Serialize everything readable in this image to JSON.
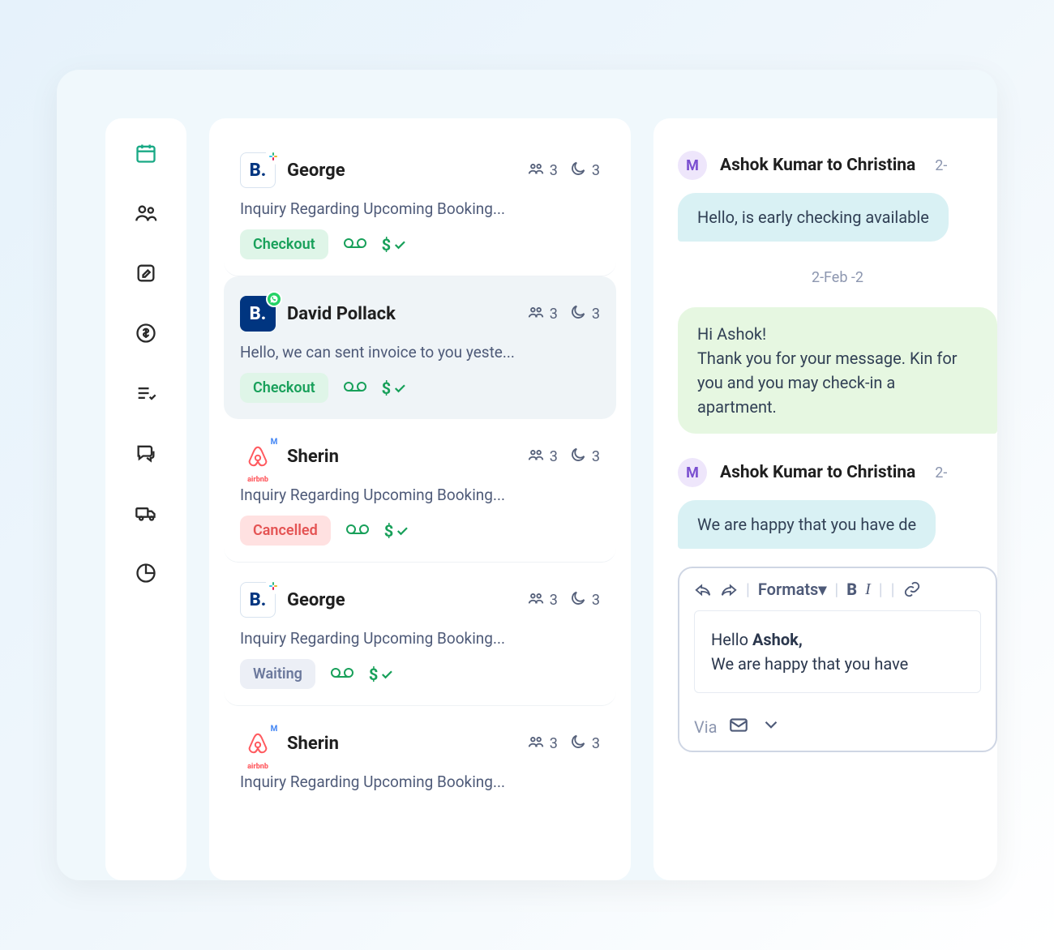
{
  "sidebar": {
    "items": [
      {
        "name": "calendar-icon",
        "active": true
      },
      {
        "name": "guests-icon",
        "active": false
      },
      {
        "name": "notes-icon",
        "active": false
      },
      {
        "name": "payments-icon",
        "active": false
      },
      {
        "name": "tasks-icon",
        "active": false
      },
      {
        "name": "chat-icon",
        "active": false
      },
      {
        "name": "truck-icon",
        "active": false
      },
      {
        "name": "reports-icon",
        "active": false
      }
    ]
  },
  "inbox": [
    {
      "source": "booking-alt",
      "overlay": "slack",
      "name": "George",
      "guests": "3",
      "nights": "3",
      "preview": "Inquiry Regarding Upcoming Booking...",
      "status": "Checkout",
      "status_kind": "checkout",
      "selected": false
    },
    {
      "source": "booking",
      "overlay": "whatsapp",
      "name": "David Pollack",
      "guests": "3",
      "nights": "3",
      "preview": "Hello, we can sent invoice to you yeste...",
      "status": "Checkout",
      "status_kind": "checkout",
      "selected": true
    },
    {
      "source": "airbnb",
      "overlay": "gmail",
      "name": "Sherin",
      "guests": "3",
      "nights": "3",
      "preview": "Inquiry Regarding Upcoming Booking...",
      "status": "Cancelled",
      "status_kind": "cancelled",
      "selected": false
    },
    {
      "source": "booking-alt",
      "overlay": "slack",
      "name": "George",
      "guests": "3",
      "nights": "3",
      "preview": "Inquiry Regarding Upcoming Booking...",
      "status": "Waiting",
      "status_kind": "waiting",
      "selected": false
    },
    {
      "source": "airbnb",
      "overlay": "gmail",
      "name": "Sherin",
      "guests": "3",
      "nights": "3",
      "preview": "Inquiry Regarding Upcoming Booking...",
      "status": "",
      "status_kind": "",
      "selected": false
    }
  ],
  "chat": {
    "avatar_initial": "M",
    "thread1_from": "Ashok Kumar to Christina",
    "thread1_time": "2-",
    "bubble_in_1": "Hello, is early checking available",
    "date_divider": "2-Feb -2",
    "bubble_out_1": "Hi Ashok!\nThank you for your message. Kin for you and you may check-in a apartment.",
    "thread2_from": "Ashok Kumar to Christina",
    "thread2_time": "2-",
    "bubble_in_2": "We are happy that you have de",
    "composer": {
      "formats_label": "Formats",
      "draft_greeting_prefix": "Hello ",
      "draft_greeting_name": "Ashok,",
      "draft_body": "We are happy that you have",
      "via_label": "Via"
    }
  }
}
